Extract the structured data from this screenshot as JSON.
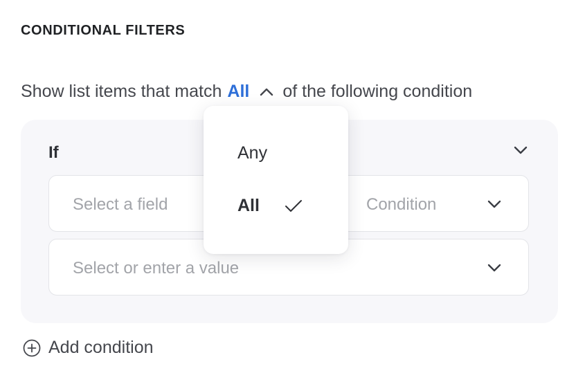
{
  "section": {
    "title": "CONDITIONAL FILTERS"
  },
  "match": {
    "prefix": "Show list items that match",
    "value": "All",
    "suffix": "of the following condition"
  },
  "condition_card": {
    "if_label": "If",
    "field_placeholder": "Select a field",
    "condition_placeholder": "Condition",
    "value_placeholder": "Select or enter a value"
  },
  "dropdown": {
    "options": [
      {
        "label": "Any",
        "selected": false
      },
      {
        "label": "All",
        "selected": true
      }
    ]
  },
  "actions": {
    "add_condition_label": "Add condition"
  },
  "icons": {
    "match_toggle": "chevron-up-icon",
    "collapse": "chevron-down-icon",
    "selected": "check-icon",
    "add": "plus-circle-icon"
  },
  "colors": {
    "accent": "#2e6fd8",
    "card_bg": "#f7f7fa",
    "placeholder": "#a2a4a9",
    "text": "#2f3136"
  }
}
